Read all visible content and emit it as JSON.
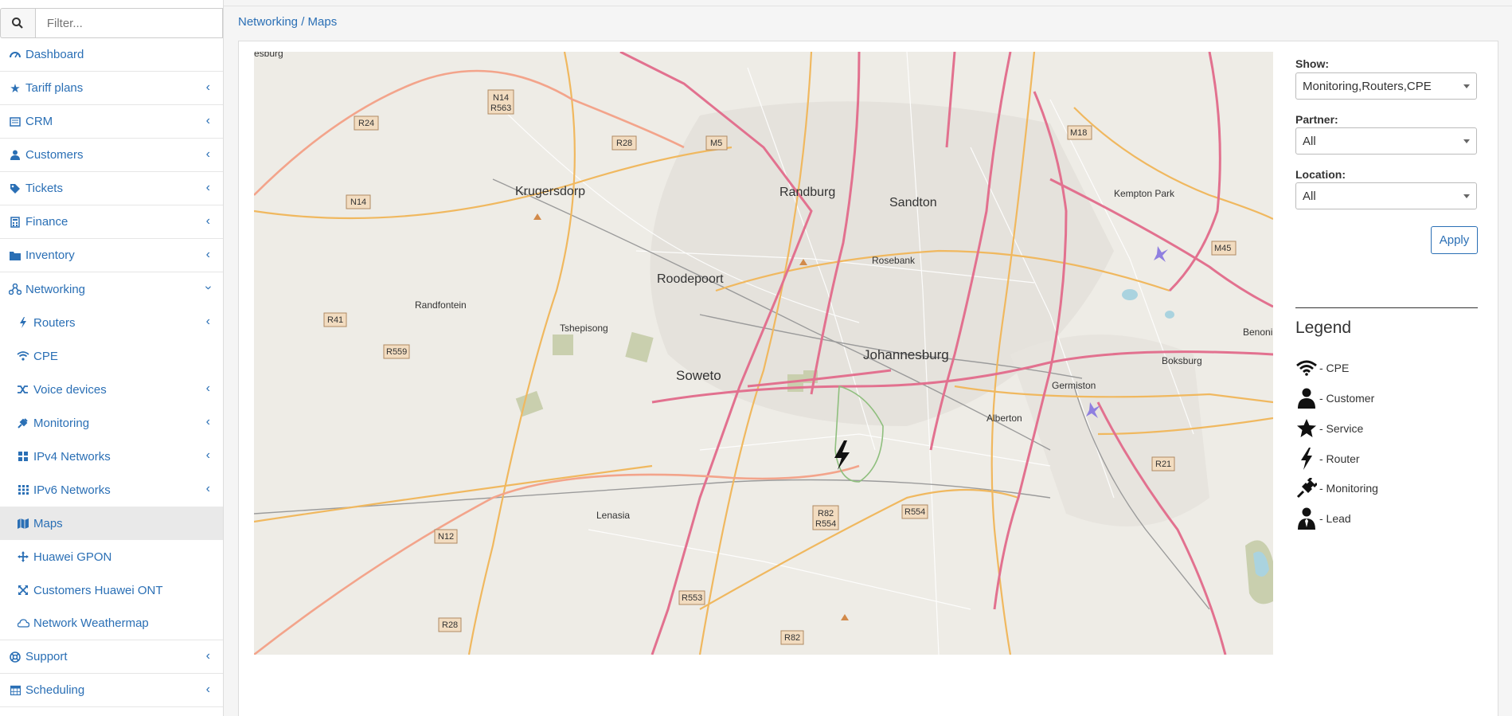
{
  "search": {
    "placeholder": "Filter..."
  },
  "breadcrumb": "Networking / Maps",
  "sidebar": {
    "items": [
      {
        "label": "Dashboard",
        "icon": "dashboard-icon"
      },
      {
        "label": "Tariff plans",
        "icon": "star-icon"
      },
      {
        "label": "CRM",
        "icon": "crm-icon"
      },
      {
        "label": "Customers",
        "icon": "user-icon"
      },
      {
        "label": "Tickets",
        "icon": "tag-icon"
      },
      {
        "label": "Finance",
        "icon": "calculator-icon"
      },
      {
        "label": "Inventory",
        "icon": "folder-icon"
      },
      {
        "label": "Networking",
        "icon": "network-icon"
      },
      {
        "label": "Routers",
        "icon": "bolt-icon"
      },
      {
        "label": "CPE",
        "icon": "wifi-icon"
      },
      {
        "label": "Voice devices",
        "icon": "shuffle-icon"
      },
      {
        "label": "Monitoring",
        "icon": "plug-icon"
      },
      {
        "label": "IPv4 Networks",
        "icon": "grid-icon"
      },
      {
        "label": "IPv6 Networks",
        "icon": "grid-dots-icon"
      },
      {
        "label": "Maps",
        "icon": "map-icon"
      },
      {
        "label": "Huawei GPON",
        "icon": "arrows-icon"
      },
      {
        "label": "Customers Huawei ONT",
        "icon": "expand-icon"
      },
      {
        "label": "Network Weathermap",
        "icon": "cloud-icon"
      },
      {
        "label": "Support",
        "icon": "lifebuoy-icon"
      },
      {
        "label": "Scheduling",
        "icon": "calendar-icon"
      }
    ]
  },
  "filters": {
    "show_label": "Show:",
    "show_value": "Monitoring,Routers,CPE",
    "partner_label": "Partner:",
    "partner_value": "All",
    "location_label": "Location:",
    "location_value": "All",
    "apply_label": "Apply"
  },
  "legend": {
    "title": "Legend",
    "items": [
      {
        "label": "- CPE",
        "icon": "wifi-icon"
      },
      {
        "label": "- Customer",
        "icon": "user-icon"
      },
      {
        "label": "- Service",
        "icon": "star-icon"
      },
      {
        "label": "- Router",
        "icon": "bolt-icon"
      },
      {
        "label": "- Monitoring",
        "icon": "plug-icon"
      },
      {
        "label": "- Lead",
        "icon": "user-tie-icon"
      }
    ]
  },
  "map": {
    "places": [
      "Krugersdorp",
      "Randburg",
      "Sandton",
      "Kempton Park",
      "Roodepoort",
      "Rosebank",
      "Randfontein",
      "Tshepisong",
      "Soweto",
      "Johannesburg",
      "Germiston",
      "Alberton",
      "Boksburg",
      "Benoni",
      "Lenasia",
      "esburg"
    ],
    "route_shields": [
      "N14 R563",
      "R24",
      "N14",
      "R28",
      "M5",
      "M18",
      "R41",
      "R559",
      "M45",
      "R21",
      "R82 R554",
      "R554",
      "N12",
      "R553",
      "R28",
      "R82"
    ]
  },
  "colors": {
    "accent": "#2a6fb5",
    "map_bg": "#eeece6",
    "road_major": "#e2718f",
    "road_secondary": "#f0b85f"
  }
}
